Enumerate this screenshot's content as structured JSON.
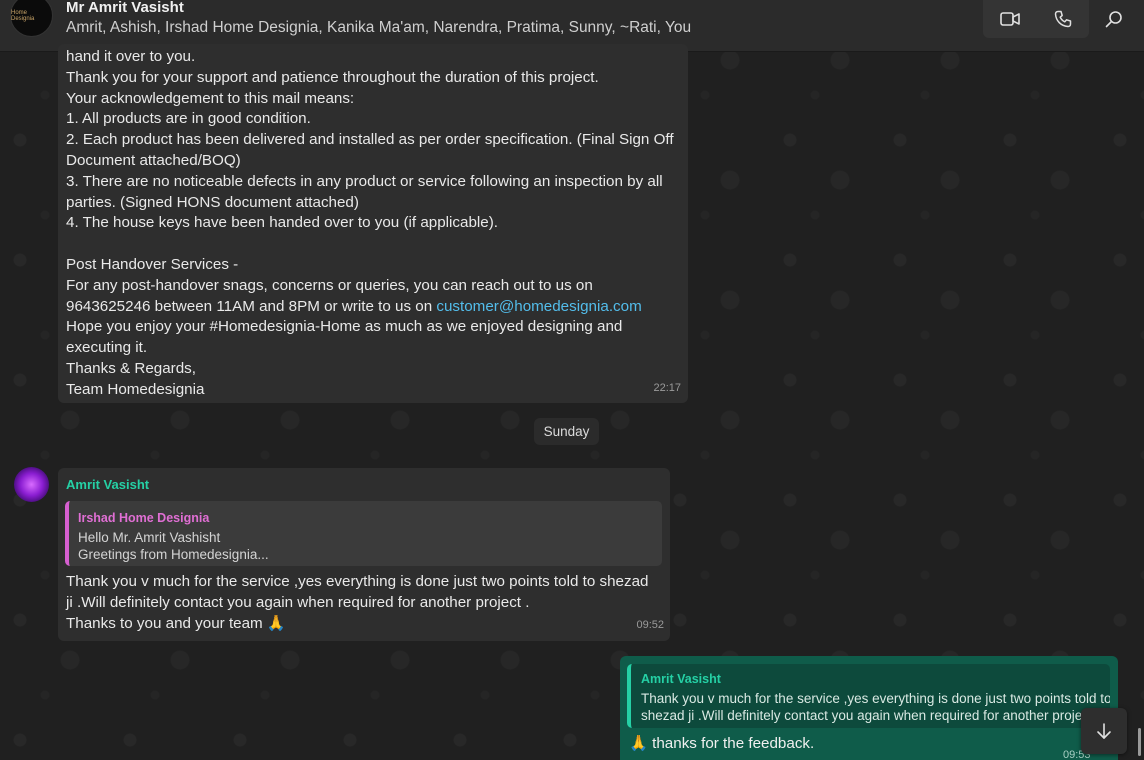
{
  "header": {
    "avatar_text": "Home Designia",
    "title": "Mr Amrit Vasisht",
    "members": "Amrit, Ashish, Irshad Home Designia, Kanika Ma'am, Narendra, Pratima, Sunny, ~Rati, You",
    "icons": [
      "video-call-icon",
      "voice-call-icon",
      "search-icon"
    ]
  },
  "messages": {
    "m1": {
      "lines": [
        "hand it over to you.",
        "Thank you for your support and patience throughout the duration of this project.",
        "Your acknowledgement to this mail means:",
        "1. All products are in good condition.",
        "2. Each product has been delivered and installed as per order specification. (Final Sign Off",
        "Document attached/BOQ)",
        "3. There are no noticeable defects in any product or service following an inspection by all",
        "parties. (Signed HONS document attached)",
        "4. The house keys have been handed over to you (if applicable).",
        "",
        "Post Handover Services -",
        "For any post-handover snags, concerns or queries, you can reach out to us on",
        "9643625246 between 11AM and 8PM or write to us on "
      ],
      "link": "customer@homedesignia.com",
      "lines_after": [
        "Hope you enjoy your #Homedesignia-Home as much as we enjoyed designing and",
        "executing it.",
        "Thanks & Regards,",
        "Team Homedesignia"
      ],
      "time": "22:17"
    },
    "date_separator": "Sunday",
    "m2": {
      "sender": "Amrit Vasisht",
      "quote": {
        "name": "Irshad Home Designia",
        "line1": "Hello Mr. Amrit Vashisht",
        "line2": "Greetings from Homedesignia..."
      },
      "lines": [
        "Thank you v much for the service ,yes everything is done just two points told to shezad",
        "ji .Will definitely contact you again when required for another project .",
        "Thanks to you and your team 🙏"
      ],
      "time": "09:52"
    },
    "m3": {
      "quote": {
        "name": "Amrit Vasisht",
        "line1": "Thank you v much for the service ,yes everything is done just two points told to",
        "line2": "shezad ji .Will definitely contact you again when required for another project ."
      },
      "text": "🙏 thanks for the feedback.",
      "time": "09:53"
    }
  },
  "colors": {
    "accent_green": "#25d0a5",
    "quote_pink": "#e06fd4",
    "link_blue": "#53bdeb",
    "outgoing_bubble": "#0f5c4a"
  }
}
